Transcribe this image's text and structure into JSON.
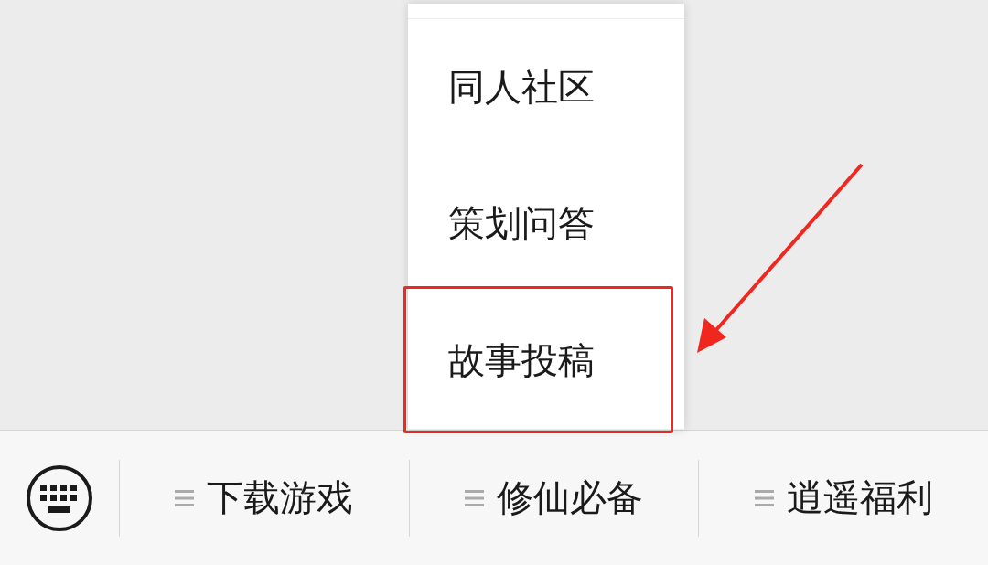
{
  "popup_menu": {
    "items": [
      {
        "label": "同人社区",
        "highlighted": false
      },
      {
        "label": "策划问答",
        "highlighted": false
      },
      {
        "label": "故事投稿",
        "highlighted": true
      }
    ]
  },
  "bottom_menu": {
    "items": [
      {
        "label": "下载游戏"
      },
      {
        "label": "修仙必备"
      },
      {
        "label": "逍遥福利"
      }
    ]
  }
}
